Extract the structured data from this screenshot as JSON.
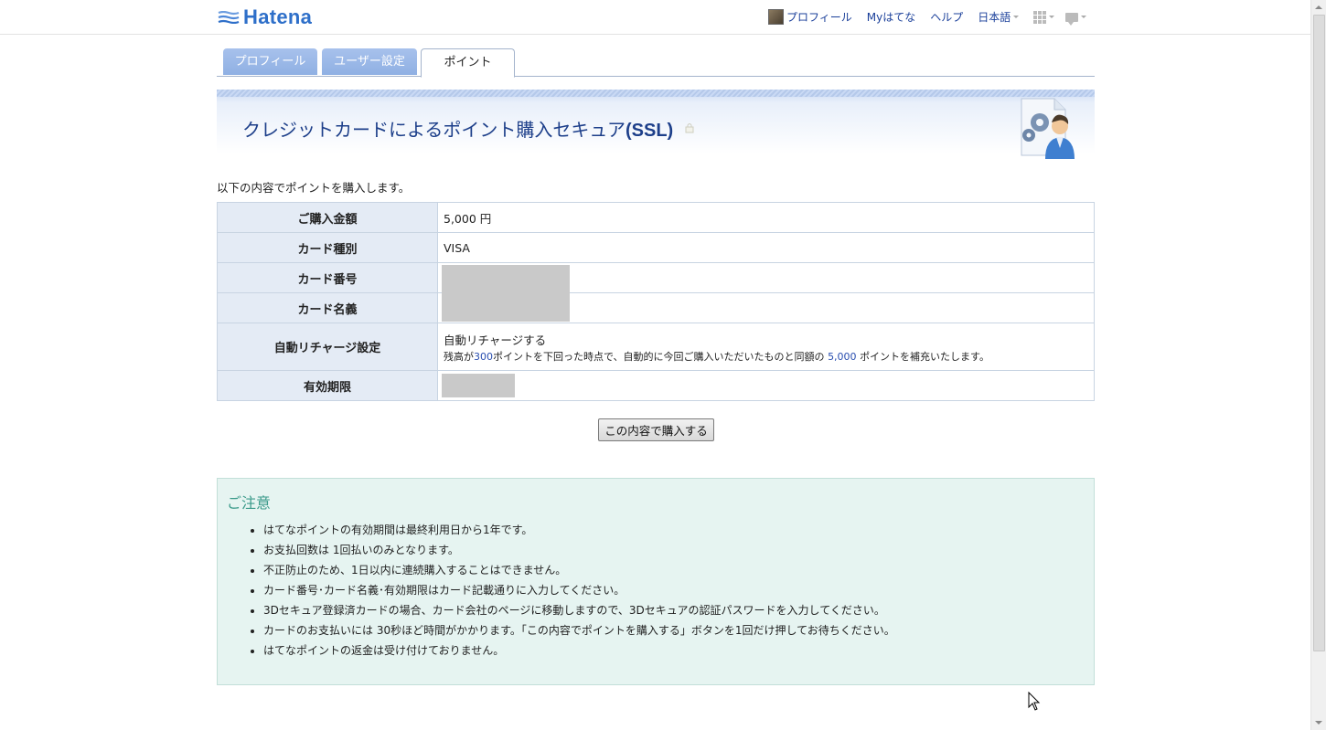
{
  "header": {
    "logo_text": "Hatena",
    "nav": {
      "profile": "プロフィール",
      "my_hatena": "Myはてな",
      "help": "ヘルプ",
      "language": "日本語"
    }
  },
  "tabs": [
    {
      "label": "プロフィール",
      "active": false
    },
    {
      "label": "ユーザー設定",
      "active": false
    },
    {
      "label": "ポイント",
      "active": true
    }
  ],
  "banner": {
    "title_main": "クレジットカードによるポイント購入セキュア",
    "title_ssl": "(SSL)"
  },
  "intro": "以下の内容でポイントを購入します。",
  "purchase": {
    "amount_label": "ご購入金額",
    "amount_value": "5,000 円",
    "card_type_label": "カード種別",
    "card_type_value": "VISA",
    "card_number_label": "カード番号",
    "card_name_label": "カード名義",
    "auto_recharge_label": "自動リチャージ設定",
    "auto_recharge_value": "自動リチャージする",
    "auto_recharge_note_1": "残高が",
    "auto_recharge_threshold": "300",
    "auto_recharge_note_2": "ポイントを下回った時点で、自動的に今回ご購入いただいたものと同額の",
    "auto_recharge_amount": "5,000",
    "auto_recharge_note_3": "ポイントを補充いたします。",
    "expiry_label": "有効期限"
  },
  "submit_label": "この内容で購入する",
  "notice": {
    "title": "ご注意",
    "items": [
      "はてなポイントの有効期間は最終利用日から1年です。",
      "お支払回数は 1回払いのみとなります。",
      "不正防止のため、1日以内に連続購入することはできません。",
      "カード番号･カード名義･有効期限はカード記載通りに入力してください。",
      "3Dセキュア登録済カードの場合、カード会社のページに移動しますので、3Dセキュアの認証パスワードを入力してください。",
      "カードのお支払いには 30秒ほど時間がかかります。「この内容でポイントを購入する」ボタンを1回だけ押してお待ちください。",
      "はてなポイントの返金は受け付けておりません。"
    ]
  },
  "colors": {
    "link": "#1a3f9a",
    "brand": "#2e6fc9",
    "tab_inactive": "#9bb8e8",
    "table_header_bg": "#e4ebf5",
    "notice_bg": "#e6f4f1",
    "notice_title": "#3b9a8a"
  }
}
